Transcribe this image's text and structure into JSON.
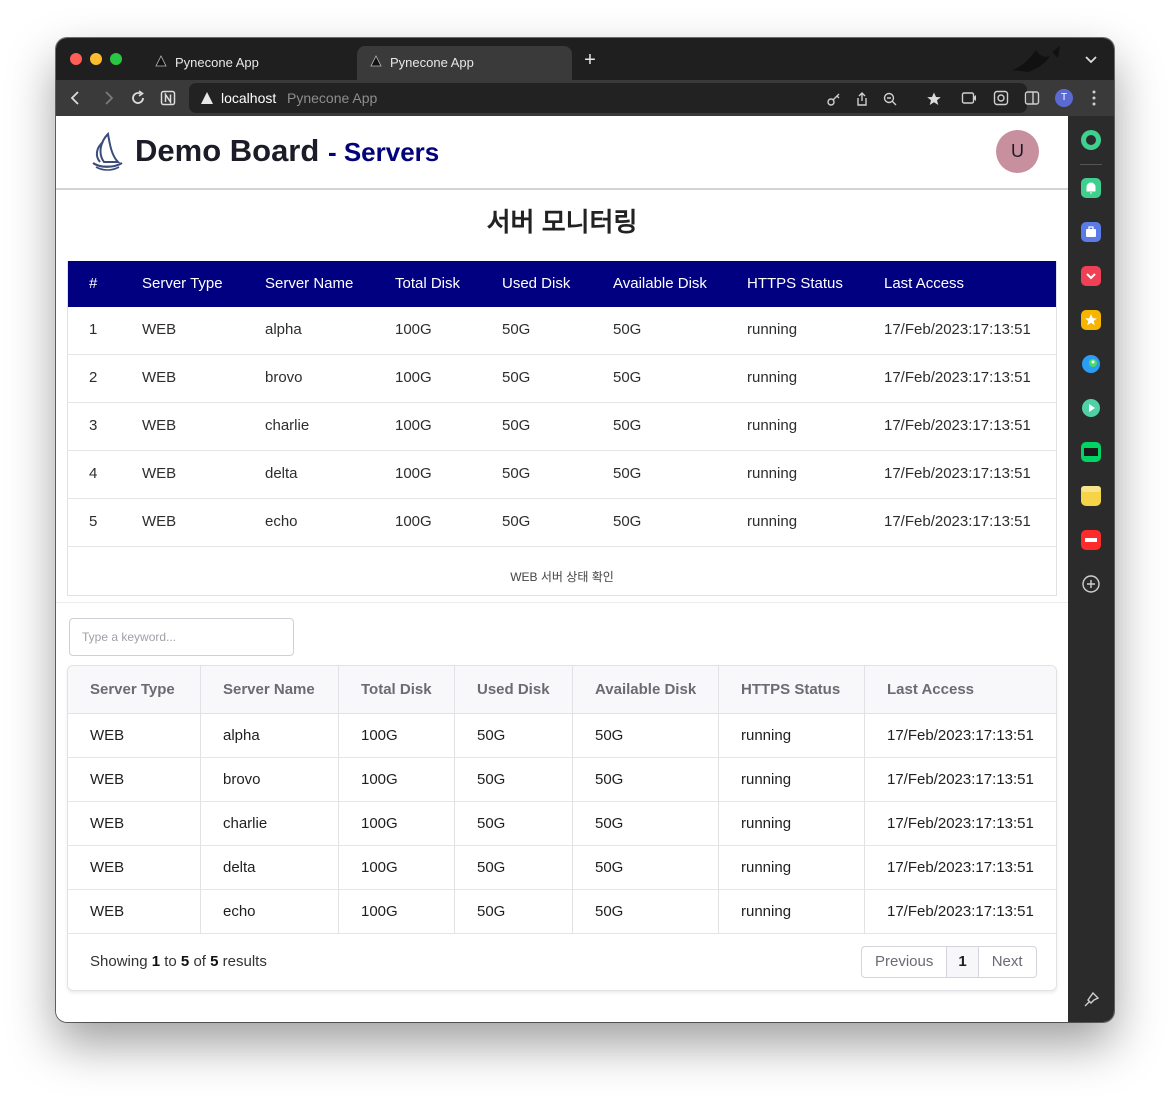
{
  "browser": {
    "tabs": [
      {
        "title": "Pynecone App",
        "active": false
      },
      {
        "title": "Pynecone App",
        "active": true
      }
    ],
    "address": {
      "host": "localhost",
      "page_title": "Pynecone App"
    },
    "profile_initial": "T"
  },
  "header": {
    "brand": "Demo Board",
    "section": "- Servers",
    "avatar_initial": "U"
  },
  "page_title": "서버 모니터링",
  "table1": {
    "columns": [
      "#",
      "Server Type",
      "Server Name",
      "Total Disk",
      "Used Disk",
      "Available Disk",
      "HTTPS Status",
      "Last Access"
    ],
    "rows": [
      [
        "1",
        "WEB",
        "alpha",
        "100G",
        "50G",
        "50G",
        "running",
        "17/Feb/2023:17:13:51"
      ],
      [
        "2",
        "WEB",
        "brovo",
        "100G",
        "50G",
        "50G",
        "running",
        "17/Feb/2023:17:13:51"
      ],
      [
        "3",
        "WEB",
        "charlie",
        "100G",
        "50G",
        "50G",
        "running",
        "17/Feb/2023:17:13:51"
      ],
      [
        "4",
        "WEB",
        "delta",
        "100G",
        "50G",
        "50G",
        "running",
        "17/Feb/2023:17:13:51"
      ],
      [
        "5",
        "WEB",
        "echo",
        "100G",
        "50G",
        "50G",
        "running",
        "17/Feb/2023:17:13:51"
      ]
    ],
    "caption": "WEB 서버 상태 확인"
  },
  "search": {
    "placeholder": "Type a keyword..."
  },
  "table2": {
    "columns": [
      "Server Type",
      "Server Name",
      "Total Disk",
      "Used Disk",
      "Available Disk",
      "HTTPS Status",
      "Last Access"
    ],
    "rows": [
      [
        "WEB",
        "alpha",
        "100G",
        "50G",
        "50G",
        "running",
        "17/Feb/2023:17:13:51"
      ],
      [
        "WEB",
        "brovo",
        "100G",
        "50G",
        "50G",
        "running",
        "17/Feb/2023:17:13:51"
      ],
      [
        "WEB",
        "charlie",
        "100G",
        "50G",
        "50G",
        "running",
        "17/Feb/2023:17:13:51"
      ],
      [
        "WEB",
        "delta",
        "100G",
        "50G",
        "50G",
        "running",
        "17/Feb/2023:17:13:51"
      ],
      [
        "WEB",
        "echo",
        "100G",
        "50G",
        "50G",
        "running",
        "17/Feb/2023:17:13:51"
      ]
    ],
    "footer": {
      "showing": "Showing",
      "from": "1",
      "to_word": "to",
      "to": "5",
      "of_word": "of",
      "total": "5",
      "results": "results"
    },
    "pagination": {
      "previous": "Previous",
      "page": "1",
      "next": "Next"
    }
  },
  "sidebar_apps": [
    "chatgpt-icon",
    "notification-icon",
    "briefcase-icon",
    "pocket-icon",
    "star-icon",
    "bird-icon",
    "play-icon",
    "webtoon-icon",
    "notes-icon",
    "now-icon",
    "add-icon",
    "pin-icon"
  ],
  "colors": {
    "header_bar": "#000080",
    "accent": "#02027a",
    "avatar": "#c8909e"
  }
}
